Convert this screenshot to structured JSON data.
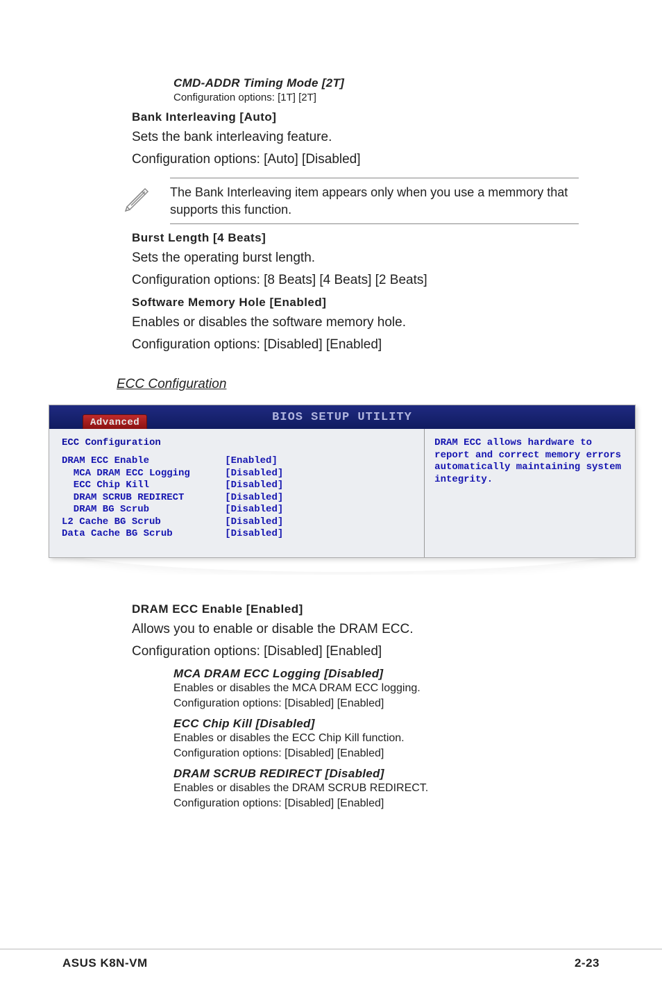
{
  "cmd_timing": {
    "title": "CMD-ADDR Timing Mode [2T]",
    "desc": "Configuration options: [1T] [2T]"
  },
  "bank_interleaving": {
    "title": "Bank Interleaving [Auto]",
    "line1": "Sets the bank interleaving feature.",
    "line2": "Configuration options: [Auto] [Disabled]"
  },
  "note": {
    "text": "The Bank Interleaving item appears only when you use a memmory that supports this function."
  },
  "burst_length": {
    "title": "Burst Length [4 Beats]",
    "line1": "Sets the operating burst length.",
    "line2": "Configuration options: [8 Beats] [4 Beats] [2 Beats]"
  },
  "software_memory_hole": {
    "title": "Software Memory Hole [Enabled]",
    "line1": "Enables or disables the software memory hole.",
    "line2": "Configuration options: [Disabled] [Enabled]"
  },
  "ecc_section_title": "ECC Configuration",
  "bios": {
    "header_title": "BIOS SETUP UTILITY",
    "tab": "Advanced",
    "panel_title": "ECC Configuration",
    "rows": [
      {
        "k": "DRAM ECC Enable",
        "v": "[Enabled]",
        "indent": 0
      },
      {
        "k": "MCA DRAM ECC Logging",
        "v": "[Disabled]",
        "indent": 1
      },
      {
        "k": "ECC Chip Kill",
        "v": "[Disabled]",
        "indent": 1
      },
      {
        "k": "DRAM SCRUB REDIRECT",
        "v": "[Disabled]",
        "indent": 1
      },
      {
        "k": "DRAM BG Scrub",
        "v": "[Disabled]",
        "indent": 1
      },
      {
        "k": "L2 Cache BG Scrub",
        "v": "[Disabled]",
        "indent": 0
      },
      {
        "k": "Data Cache BG Scrub",
        "v": "[Disabled]",
        "indent": 0
      }
    ],
    "help": "DRAM ECC allows hardware to report and correct memory errors automatically maintaining system integrity."
  },
  "dram_ecc_enable": {
    "title": "DRAM ECC Enable [Enabled]",
    "line1": "Allows you to enable or disable the DRAM ECC.",
    "line2": "Configuration options: [Disabled] [Enabled]"
  },
  "mca_logging": {
    "title": "MCA DRAM ECC Logging [Disabled]",
    "line1": "Enables or disables the MCA DRAM ECC logging.",
    "line2": "Configuration options: [Disabled] [Enabled]"
  },
  "ecc_chip_kill": {
    "title": "ECC Chip Kill [Disabled]",
    "line1": "Enables or disables the ECC Chip Kill function.",
    "line2": "Configuration options: [Disabled] [Enabled]"
  },
  "dram_scrub_redirect": {
    "title": "DRAM SCRUB REDIRECT [Disabled]",
    "line1": "Enables or disables the DRAM SCRUB REDIRECT.",
    "line2": "Configuration options: [Disabled] [Enabled]"
  },
  "footer": {
    "left": "ASUS K8N-VM",
    "right": "2-23"
  }
}
